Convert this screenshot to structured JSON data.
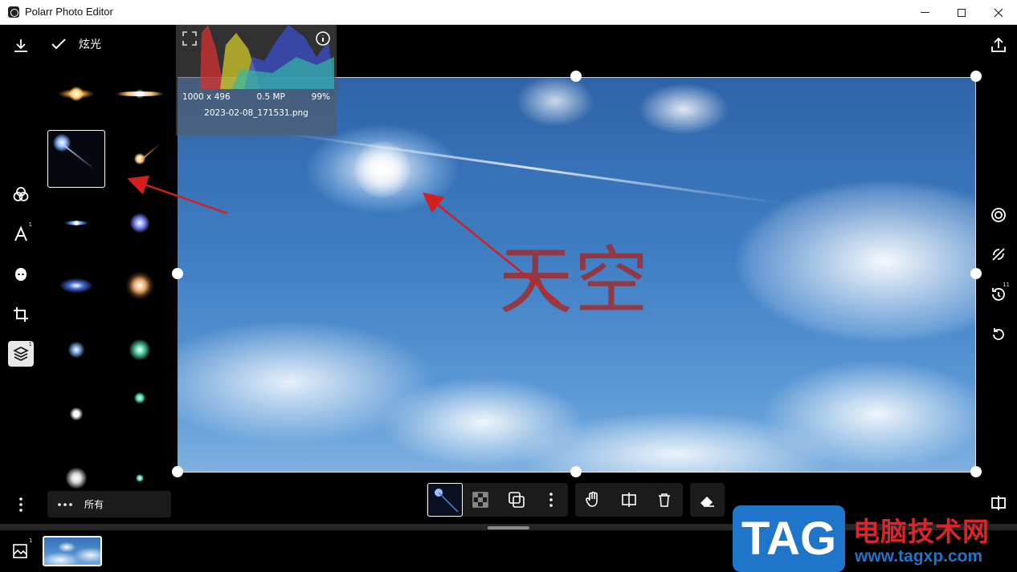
{
  "window": {
    "title": "Polarr Photo Editor"
  },
  "panel": {
    "title": "炫光",
    "filter_label": "所有"
  },
  "image_info": {
    "dimensions": "1000 x 496",
    "megapixels": "0.5 MP",
    "zoom": "99%",
    "filename": "2023-02-08_171531.png"
  },
  "photo": {
    "overlay_text": "天空"
  },
  "badges": {
    "text_layers": "1",
    "layers": "1",
    "history": "11",
    "images": "1"
  },
  "watermark": {
    "tag": "TAG",
    "title": "电脑技术网",
    "url": "www.tagxp.com"
  },
  "colors": {
    "accent_arrow": "#d41f1f",
    "watermark_blue": "#1f75c9",
    "watermark_red": "#d9262c"
  },
  "icons": {
    "left_rail": [
      "download-icon",
      "filters-icon",
      "text-icon",
      "face-icon",
      "crop-icon",
      "layers-icon",
      "more-icon"
    ],
    "right_rail": [
      "share-icon",
      "spiral-icon",
      "mask-toggle-icon",
      "history-icon",
      "reset-icon"
    ],
    "bottom_tools": [
      "flare-thumb-icon",
      "opacity-icon",
      "blend-icon",
      "more-icon",
      "hand-icon",
      "flip-icon",
      "delete-icon",
      "eraser-icon"
    ]
  }
}
